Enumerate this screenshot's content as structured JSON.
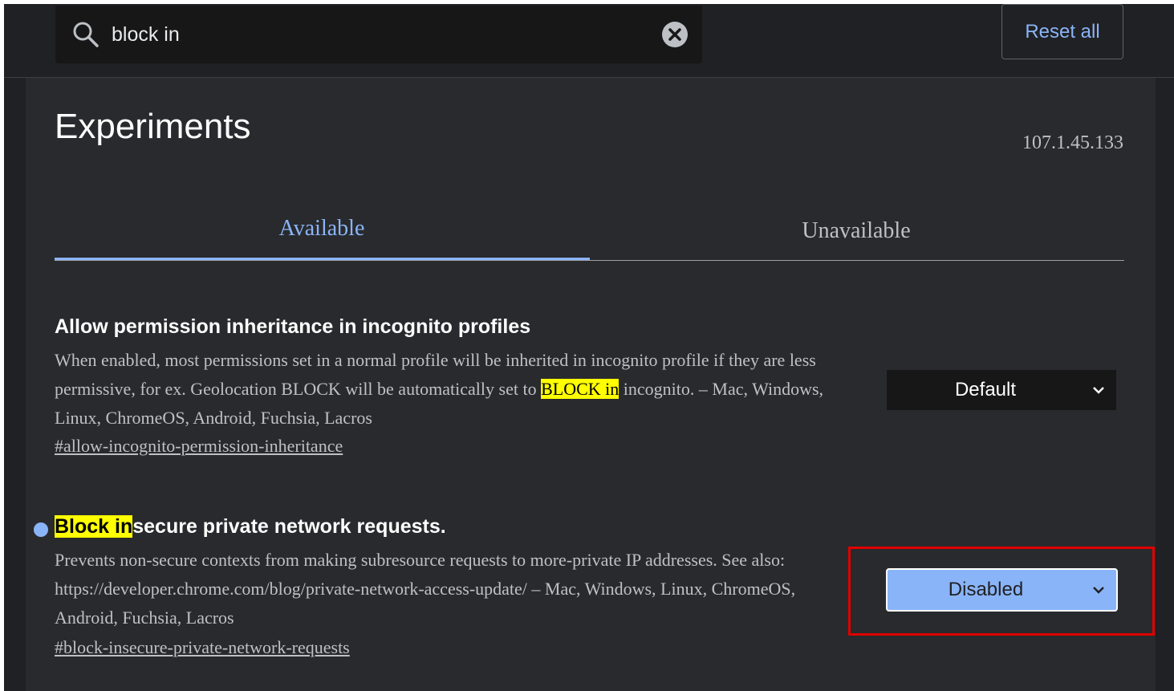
{
  "search": {
    "value": "block in"
  },
  "header": {
    "reset_label": "Reset all"
  },
  "page": {
    "title": "Experiments",
    "version": "107.1.45.133"
  },
  "tabs": [
    {
      "label": "Available",
      "selected": true
    },
    {
      "label": "Unavailable",
      "selected": false
    }
  ],
  "experiments": [
    {
      "title": "Allow permission inheritance in incognito profiles",
      "desc_before": "When enabled, most permissions set in a normal profile will be inherited in incognito profile if they are less permissive, for ex. Geolocation BLOCK will be automatically set to ",
      "desc_highlight": "BLOCK in",
      "desc_after": " incognito. – Mac, Windows, Linux, ChromeOS, Android, Fuchsia, Lacros",
      "link": "#allow-incognito-permission-inheritance",
      "selected_option": "Default"
    },
    {
      "title_highlight": "Block in",
      "title_rest": "secure private network requests.",
      "desc": "Prevents non-secure contexts from making subresource requests to more-private IP addresses. See also: https://developer.chrome.com/blog/private-network-access-update/ – Mac, Windows, Linux, ChromeOS, Android, Fuchsia, Lacros",
      "link": "#block-insecure-private-network-requests",
      "selected_option": "Disabled",
      "modified": true
    }
  ],
  "colors": {
    "background": "#202124",
    "panel": "#292a2d",
    "accent": "#8ab4f8",
    "highlight": "#ffff00",
    "annotation": "#e00000"
  },
  "icons": {
    "search": "search-icon",
    "clear": "clear-icon",
    "dropdown": "chevron-down-icon"
  }
}
